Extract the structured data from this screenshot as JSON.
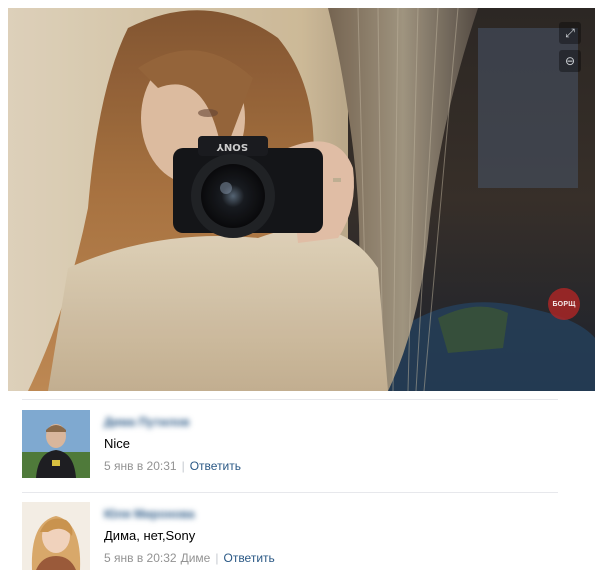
{
  "photo": {
    "camera_brand": "SONY",
    "watermark": "БОРЩ",
    "expand_icon": "expand-icon",
    "zoom_icon": "zoom-icon"
  },
  "comments": [
    {
      "author": "Дима Путилов",
      "text": "Nice",
      "time": "5 янв в 20:31",
      "reply_to": "",
      "reply_label": "Ответить"
    },
    {
      "author": "Юля Миронова",
      "text": "Дима, нет,Sony",
      "time": "5 янв в 20:32",
      "reply_to": "Диме",
      "reply_label": "Ответить"
    }
  ],
  "colors": {
    "link": "#2a5885",
    "meta": "#939393",
    "divider": "#e7e8ec"
  }
}
